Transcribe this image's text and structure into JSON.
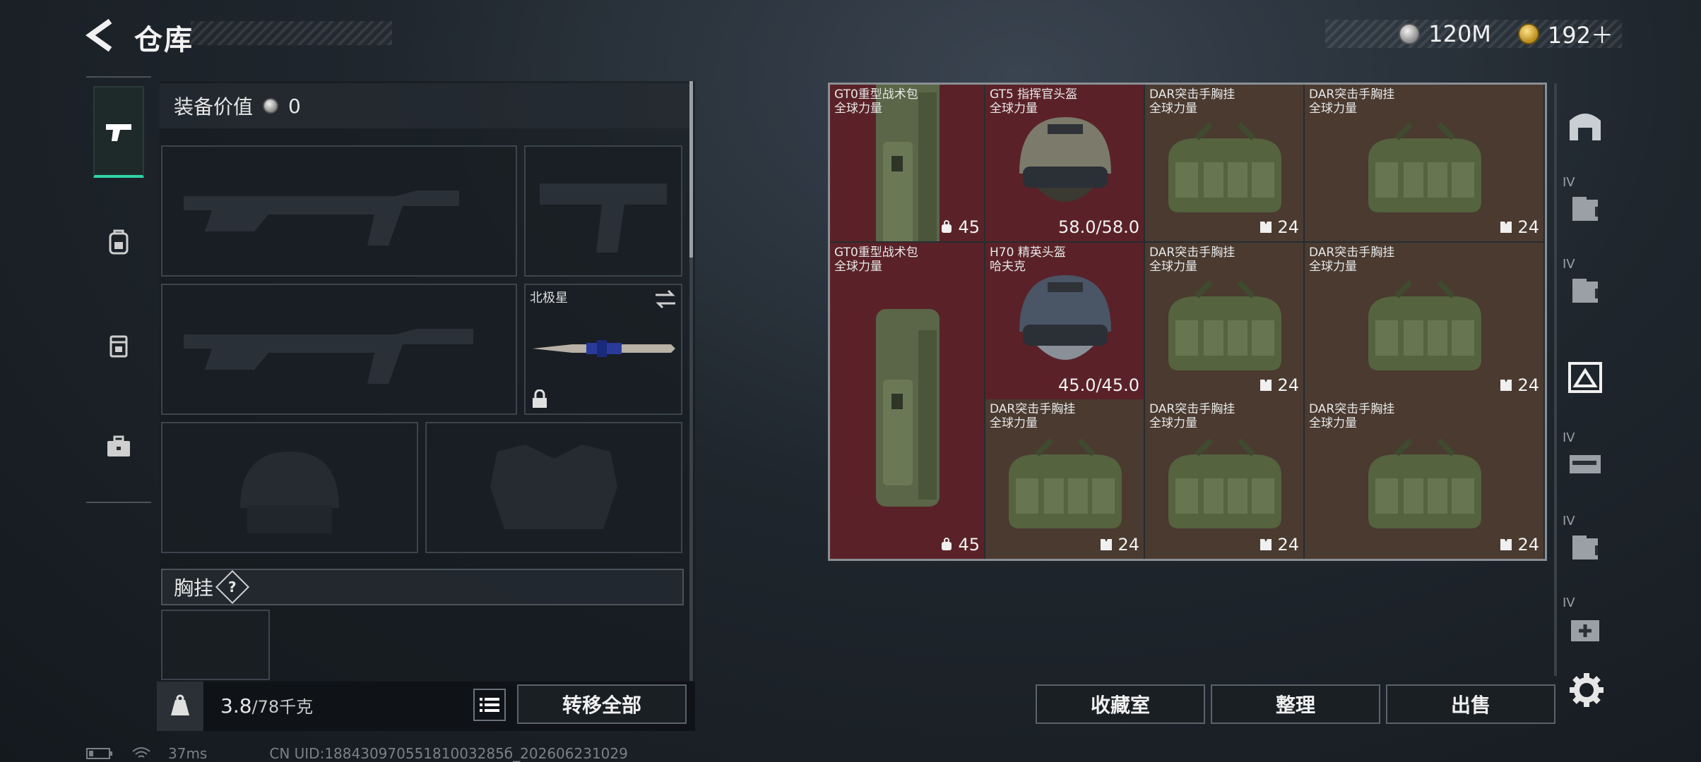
{
  "header": {
    "title": "仓库",
    "currency": [
      {
        "icon": "silver-coin-icon",
        "value": "120M"
      },
      {
        "icon": "gold-coin-icon",
        "value": "192＋"
      }
    ]
  },
  "left_nav": [
    {
      "icon": "pistol-icon",
      "active": true
    },
    {
      "icon": "backpack-icon",
      "active": false
    },
    {
      "icon": "pouch-icon",
      "active": false
    },
    {
      "icon": "toolbox-icon",
      "active": false
    }
  ],
  "loadout": {
    "value_label": "装备价值",
    "value": "0",
    "melee_slot_label": "北极星",
    "chest_label": "胸挂",
    "chest_help": "?"
  },
  "weight": {
    "current": "3.8",
    "max": "/78千克"
  },
  "buttons": {
    "transfer_all": "转移全部",
    "collection": "收藏室",
    "sort": "整理",
    "sell": "出售"
  },
  "grid_items": [
    {
      "name": "GT0重型战术包",
      "sub": "全球力量",
      "stat": "45",
      "stat_icon": "capacity-icon",
      "color": "red"
    },
    {
      "name": "GT5 指挥官头盔",
      "sub": "全球力量",
      "stat": "58.0/58.0",
      "stat_icon": "",
      "color": "red"
    },
    {
      "name": "DAR突击手胸挂",
      "sub": "全球力量",
      "stat": "24",
      "stat_icon": "vest-icon",
      "color": "brown"
    },
    {
      "name": "DAR突击手胸挂",
      "sub": "全球力量",
      "stat": "24",
      "stat_icon": "vest-icon",
      "color": "brown"
    },
    {
      "name": "H70 精英头盔",
      "sub": "哈夫克",
      "stat": "45.0/45.0",
      "stat_icon": "",
      "color": "red"
    },
    {
      "name": "DAR突击手胸挂",
      "sub": "全球力量",
      "stat": "24",
      "stat_icon": "vest-icon",
      "color": "brown"
    },
    {
      "name": "DAR突击手胸挂",
      "sub": "全球力量",
      "stat": "24",
      "stat_icon": "vest-icon",
      "color": "brown"
    },
    {
      "name": "GT0重型战术包",
      "sub": "全球力量",
      "stat": "45",
      "stat_icon": "capacity-icon",
      "color": "red"
    },
    {
      "name": "DAR突击手胸挂",
      "sub": "全球力量",
      "stat": "24",
      "stat_icon": "vest-icon",
      "color": "brown"
    },
    {
      "name": "DAR突击手胸挂",
      "sub": "全球力量",
      "stat": "24",
      "stat_icon": "vest-icon",
      "color": "brown"
    },
    {
      "name": "DAR突击手胸挂",
      "sub": "全球力量",
      "stat": "24",
      "stat_icon": "vest-icon",
      "color": "brown"
    }
  ],
  "right_nav": [
    {
      "icon": "storage-shelf-icon",
      "badge": ""
    },
    {
      "icon": "storage-box-icon",
      "badge": "IV"
    },
    {
      "icon": "storage-box-icon",
      "badge": "IV"
    },
    {
      "icon": "storage-box-icon",
      "badge": ""
    },
    {
      "icon": "gun-case-icon",
      "badge": "IV"
    },
    {
      "icon": "storage-box-icon",
      "badge": "IV"
    },
    {
      "icon": "medkit-box-icon",
      "badge": "IV"
    }
  ],
  "status": {
    "ping": "37ms",
    "uid": "CN UID:18843097055181003285б_202606231029"
  },
  "colors": {
    "accent": "#2fd4a8",
    "rare_red": "#5a2228",
    "item_brown": "#4a3a30"
  }
}
